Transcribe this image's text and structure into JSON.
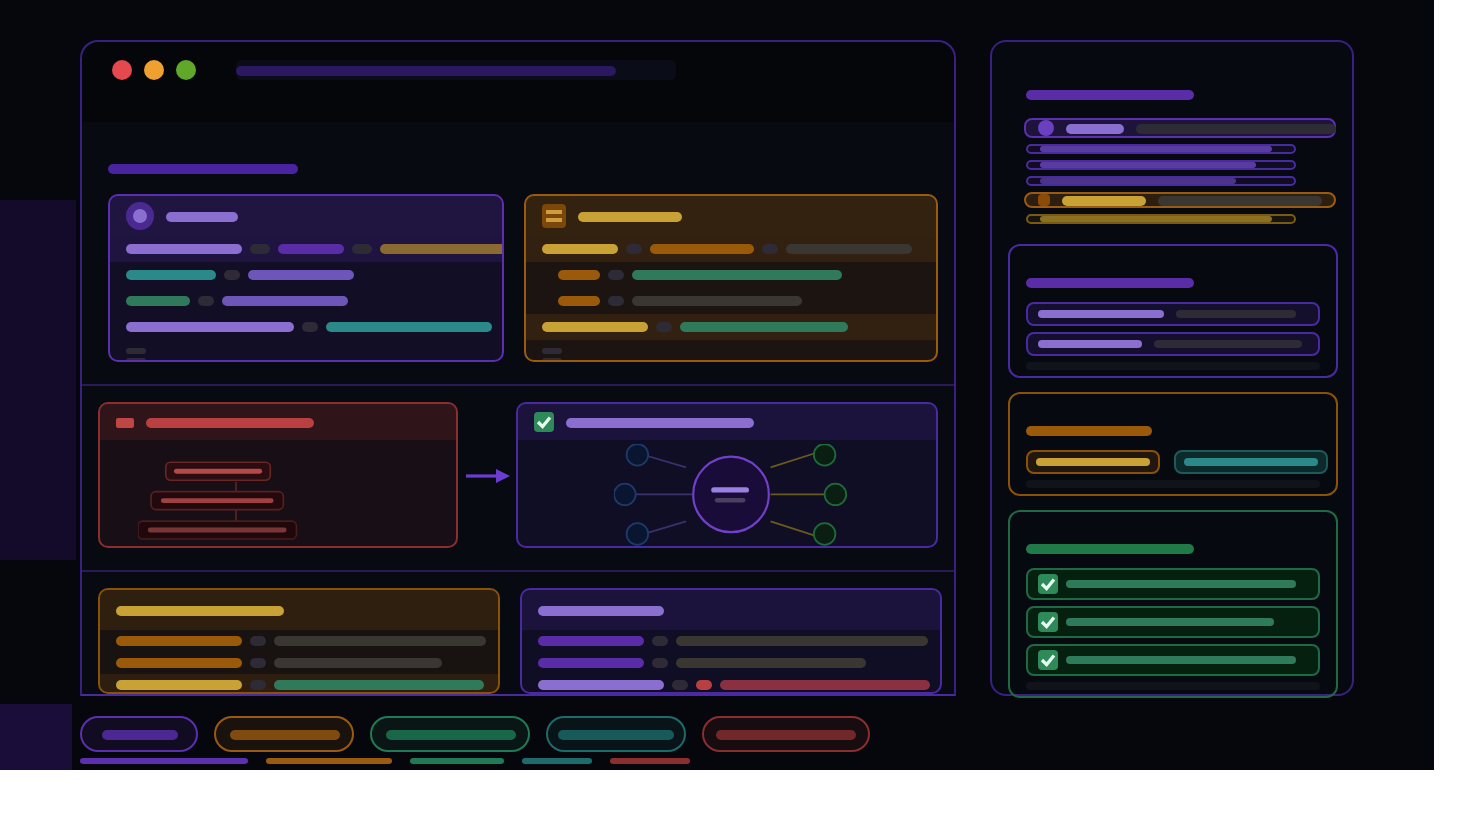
{
  "window": {
    "controls": [
      {
        "color": "#e5484d"
      },
      {
        "color": "#f0a030"
      },
      {
        "color": "#5fa82a"
      }
    ]
  },
  "main": {
    "cards": [
      {
        "kind": "list",
        "color": "#5b2fb0"
      },
      {
        "kind": "list",
        "color": "#9a5a10"
      },
      {
        "kind": "tree",
        "color": "#8a2e2e"
      },
      {
        "kind": "graph",
        "color": "#4a2aa0",
        "checked": true
      },
      {
        "kind": "list",
        "color": "#8a5208"
      },
      {
        "kind": "list",
        "color": "#4a2aa0"
      }
    ]
  },
  "filters": [
    {
      "color": "#5b2fb0"
    },
    {
      "color": "#9a5a10"
    },
    {
      "color": "#1f7a55"
    },
    {
      "color": "#1d6b6b"
    },
    {
      "color": "#8a2e2e"
    }
  ],
  "sidebar": {
    "items": [
      {
        "kind": "avatar",
        "selected": true,
        "color": "#5b2fb0"
      },
      {
        "kind": "row",
        "selected": false,
        "color": "#4a2aa0"
      },
      {
        "kind": "row",
        "selected": false,
        "color": "#4a2aa0"
      },
      {
        "kind": "row",
        "selected": false,
        "color": "#4a2aa0"
      },
      {
        "kind": "folder",
        "selected": true,
        "color": "#9a5a10"
      },
      {
        "kind": "row",
        "selected": false,
        "color": "#7a5a10"
      }
    ],
    "sections": [
      {
        "kind": "rows",
        "color": "#4a2aa0"
      },
      {
        "kind": "buttons",
        "color": "#8a5208"
      },
      {
        "kind": "checklist",
        "color": "#1f6a45",
        "items": [
          {
            "checked": true
          },
          {
            "checked": true
          },
          {
            "checked": true
          }
        ]
      }
    ]
  }
}
